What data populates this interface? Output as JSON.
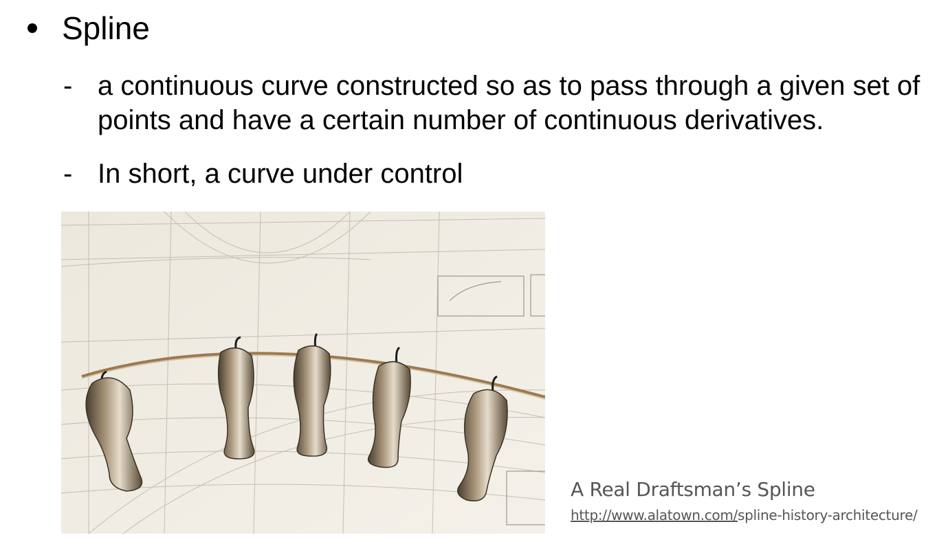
{
  "slide": {
    "title": "Spline",
    "points": [
      "a continuous curve constructed so as to pass through a given set of points and have a certain number of continuous derivatives.",
      "In short, a curve under control"
    ],
    "dash": "-"
  },
  "figure": {
    "image_icon": "draftsman-spline-photo",
    "caption": "A Real Draftsman’s Spline",
    "link_underlined": "http://www.alatown.com/",
    "link_rest": "spline-history-architecture/"
  }
}
